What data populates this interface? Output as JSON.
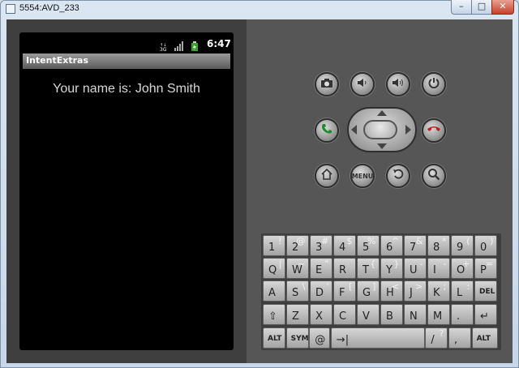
{
  "window": {
    "title": "5554:AVD_233",
    "min_glyph": "–",
    "max_glyph": "□",
    "close_glyph": "✕"
  },
  "device": {
    "status_time": "6:47",
    "status_icons": [
      "3g-icon",
      "signal-icon",
      "battery-icon"
    ],
    "app_title": "IntentExtras",
    "content_text": "Your name is: John Smith"
  },
  "controls": {
    "row1": [
      "camera-icon",
      "volume-down-icon",
      "volume-up-icon",
      "power-icon"
    ],
    "row2": [
      "call-icon",
      "dpad",
      "end-call-icon"
    ],
    "row3": [
      "home-icon",
      "menu-button",
      "back-icon",
      "search-icon"
    ],
    "menu_label": "MENU"
  },
  "keyboard": {
    "rows": [
      [
        {
          "k": "1",
          "a": "!"
        },
        {
          "k": "2",
          "a": "@"
        },
        {
          "k": "3",
          "a": "#"
        },
        {
          "k": "4",
          "a": "$"
        },
        {
          "k": "5",
          "a": "%"
        },
        {
          "k": "6",
          "a": "^"
        },
        {
          "k": "7",
          "a": "&"
        },
        {
          "k": "8",
          "a": "*"
        },
        {
          "k": "9",
          "a": "("
        },
        {
          "k": "0",
          "a": ")"
        }
      ],
      [
        {
          "k": "Q",
          "a": "|"
        },
        {
          "k": "W",
          "a": "~"
        },
        {
          "k": "E",
          "a": "\""
        },
        {
          "k": "R",
          "a": ""
        },
        {
          "k": "T",
          "a": "{"
        },
        {
          "k": "Y",
          "a": "}"
        },
        {
          "k": "U",
          "a": "-"
        },
        {
          "k": "I",
          "a": "-"
        },
        {
          "k": "O",
          "a": "+"
        },
        {
          "k": "P",
          "a": "="
        }
      ],
      [
        {
          "k": "A",
          "a": ""
        },
        {
          "k": "S",
          "a": "\\"
        },
        {
          "k": "D",
          "a": "'"
        },
        {
          "k": "F",
          "a": "["
        },
        {
          "k": "G",
          "a": "]"
        },
        {
          "k": "H",
          "a": "<"
        },
        {
          "k": "J",
          "a": ">"
        },
        {
          "k": "K",
          "a": ";"
        },
        {
          "k": "L",
          "a": ":"
        },
        {
          "k": "DEL",
          "a": ""
        }
      ],
      [
        {
          "k": "⇧",
          "a": ""
        },
        {
          "k": "Z",
          "a": ""
        },
        {
          "k": "X",
          "a": ""
        },
        {
          "k": "C",
          "a": ""
        },
        {
          "k": "V",
          "a": ""
        },
        {
          "k": "B",
          "a": ""
        },
        {
          "k": "N",
          "a": ""
        },
        {
          "k": "M",
          "a": ""
        },
        {
          "k": ".",
          "a": ""
        },
        {
          "k": "↵",
          "a": ""
        }
      ],
      [
        {
          "k": "ALT",
          "a": ""
        },
        {
          "k": "SYM",
          "a": ""
        },
        {
          "k": "@",
          "a": ""
        },
        {
          "k": "→|",
          "a": ""
        },
        {
          "k": "/",
          "a": "?"
        },
        {
          "k": ",",
          "a": ""
        },
        {
          "k": "ALT",
          "a": ""
        }
      ]
    ]
  }
}
